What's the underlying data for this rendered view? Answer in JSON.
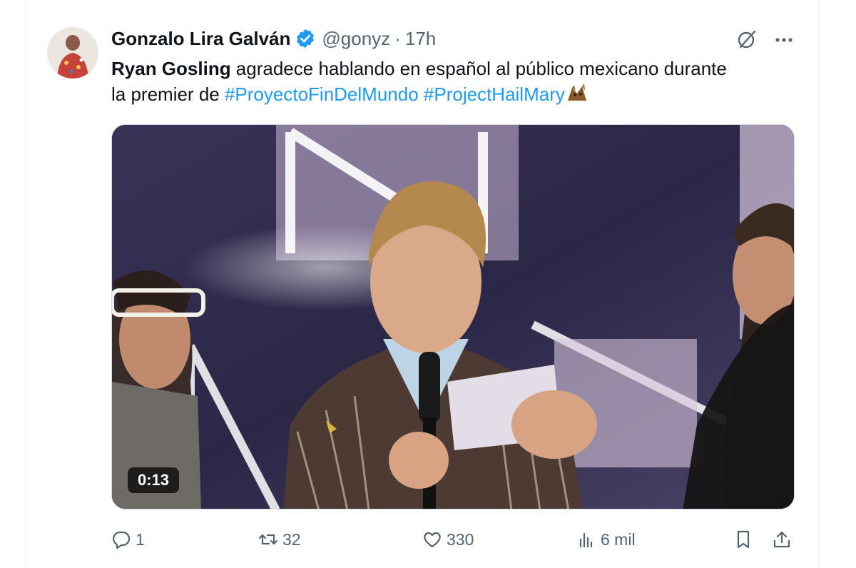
{
  "tweet": {
    "author_name": "Gonzalo Lira Galván",
    "handle": "@gonyz",
    "separator": "·",
    "time": "17h",
    "text_bold": "Ryan Gosling",
    "text_line1": " agradece hablando en español al público mexicano durante",
    "text_line2": "la premier de ",
    "hashtags": [
      "#ProyectoFinDelMundo",
      "#ProjectHailMary"
    ],
    "video_duration": "0:13"
  },
  "actions": {
    "replies": "1",
    "retweets": "32",
    "likes": "330",
    "views": "6 mil"
  },
  "colors": {
    "accent": "#1d9bf0",
    "muted": "#536471",
    "text": "#0f1419"
  },
  "icons": {
    "verified": "verified-badge-icon",
    "grok": "grok-icon",
    "more": "more-icon",
    "reply": "reply-icon",
    "retweet": "retweet-icon",
    "like": "heart-icon",
    "views": "views-icon",
    "bookmark": "bookmark-icon",
    "share": "share-icon"
  }
}
